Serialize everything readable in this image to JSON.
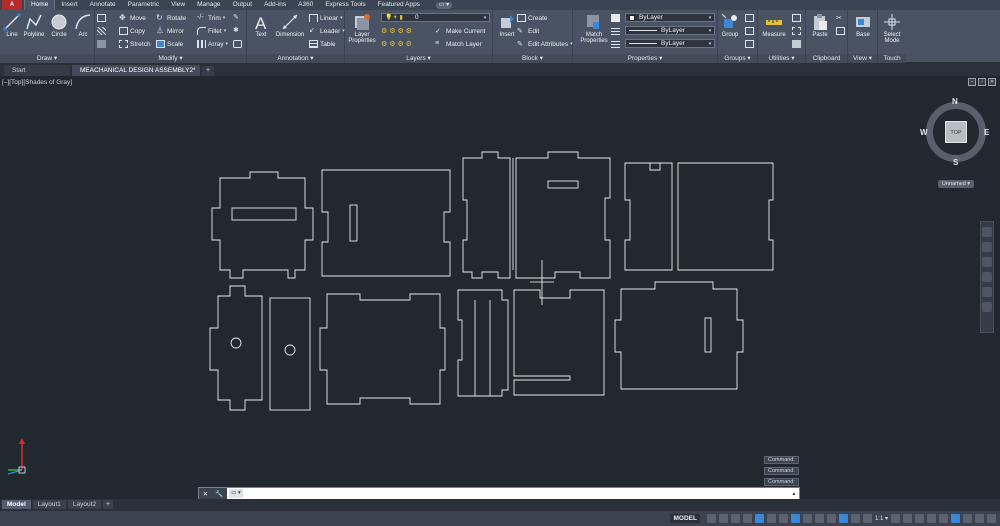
{
  "colors": {
    "canvas": "#212830",
    "ribbon": "#4a5363",
    "tabbar": "#3b4453",
    "geometry": "#e8eaec"
  },
  "app_button": "A",
  "ribbon_tabs": [
    "Home",
    "Insert",
    "Annotate",
    "Parametric",
    "View",
    "Manage",
    "Output",
    "Add-ins",
    "A360",
    "Express Tools",
    "Featured Apps"
  ],
  "ribbon_active_tab": "Home",
  "ribbon_toggle": "▭ ▾",
  "panels": {
    "draw": {
      "title": "Draw ▾",
      "big": [
        {
          "label": "Line",
          "icon": "line-icon"
        },
        {
          "label": "Polyline",
          "icon": "polyline-icon"
        },
        {
          "label": "Circle",
          "icon": "circle-icon"
        },
        {
          "label": "Arc",
          "icon": "arc-icon"
        }
      ]
    },
    "modify": {
      "title": "Modify ▾",
      "items": [
        "Move",
        "Rotate",
        "Trim",
        "Copy",
        "Mirror",
        "Fillet",
        "Stretch",
        "Scale",
        "Array"
      ]
    },
    "annotation": {
      "title": "Annotation ▾",
      "big": [
        {
          "label": "Text",
          "icon": "text-icon"
        },
        {
          "label": "Dimension",
          "icon": "dimension-icon"
        }
      ],
      "small": [
        "Linear",
        "Leader",
        "Table"
      ]
    },
    "layers": {
      "title": "Layers ▾",
      "big": {
        "label": "Layer Properties",
        "icon": "layer-properties-icon"
      },
      "layer_combo": "0",
      "small": [
        "Make Current",
        "Match Layer"
      ]
    },
    "block": {
      "title": "Block ▾",
      "big": {
        "label": "Insert",
        "icon": "insert-block-icon"
      },
      "small": [
        "Create",
        "Edit",
        "Edit Attributes"
      ]
    },
    "properties": {
      "title": "Properties ▾",
      "big": {
        "label": "Match Properties",
        "icon": "match-properties-icon"
      },
      "combos": [
        "ByLayer",
        "ByLayer",
        "ByLayer"
      ]
    },
    "groups": {
      "title": "Groups ▾",
      "big": {
        "label": "Group",
        "icon": "group-icon"
      }
    },
    "utilities": {
      "title": "Utilities ▾",
      "big": {
        "label": "Measure",
        "icon": "measure-icon"
      }
    },
    "clipboard": {
      "title": "Clipboard",
      "big": {
        "label": "Paste",
        "icon": "paste-icon"
      }
    },
    "view": {
      "title": "View ▾",
      "big": {
        "label": "Base",
        "icon": "base-view-icon"
      }
    },
    "touch": {
      "title": "Touch",
      "big": {
        "label": "Select Mode",
        "icon": "select-mode-icon"
      }
    }
  },
  "file_tabs": [
    {
      "label": "Start",
      "active": false
    },
    {
      "label": "MEACHANICAL DESIGN ASSEMBLY2*",
      "active": true
    }
  ],
  "viewport": {
    "label": "[–][Top][Shades of Gray]",
    "viewcube": {
      "n": "N",
      "s": "S",
      "e": "E",
      "w": "W",
      "face": "TOP"
    },
    "wcs": "Unnamed ▾"
  },
  "command_history": [
    "Command:",
    "Command:",
    "Command:"
  ],
  "command_line": {
    "placeholder": "",
    "prompt": "▭ ▾"
  },
  "layout_tabs": [
    {
      "label": "Model",
      "active": true
    },
    {
      "label": "Layout1",
      "active": false
    },
    {
      "label": "Layout2",
      "active": false
    }
  ],
  "status": {
    "model": "MODEL",
    "scale": "1:1 ▾"
  }
}
